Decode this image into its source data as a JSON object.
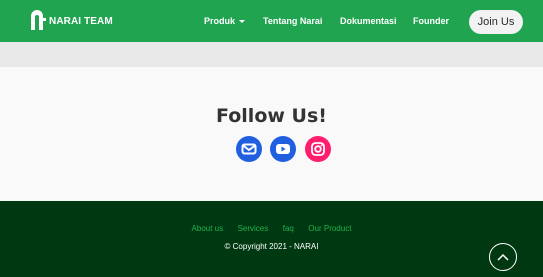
{
  "navbar": {
    "brand": "NARAI TEAM",
    "links": [
      {
        "label": "Produk"
      },
      {
        "label": "Tentang Narai"
      },
      {
        "label": "Dokumentasi"
      },
      {
        "label": "Founder"
      }
    ],
    "join_label": "Join Us"
  },
  "follow": {
    "title": "Follow Us!",
    "icons": [
      "mail-icon",
      "youtube-icon",
      "instagram-icon"
    ]
  },
  "footer": {
    "links": [
      {
        "label": "About us"
      },
      {
        "label": "Services"
      },
      {
        "label": "faq"
      },
      {
        "label": "Our Product"
      }
    ],
    "copyright": "© Copyright 2021 - NARAI"
  },
  "colors": {
    "nav_green": "#20a450",
    "footer_dark": "#003812",
    "footer_link": "#21b14a",
    "mail_blue": "#1f5fe0",
    "youtube_blue": "#1f5fe0",
    "instagram_pink": "#ff1e6e"
  }
}
